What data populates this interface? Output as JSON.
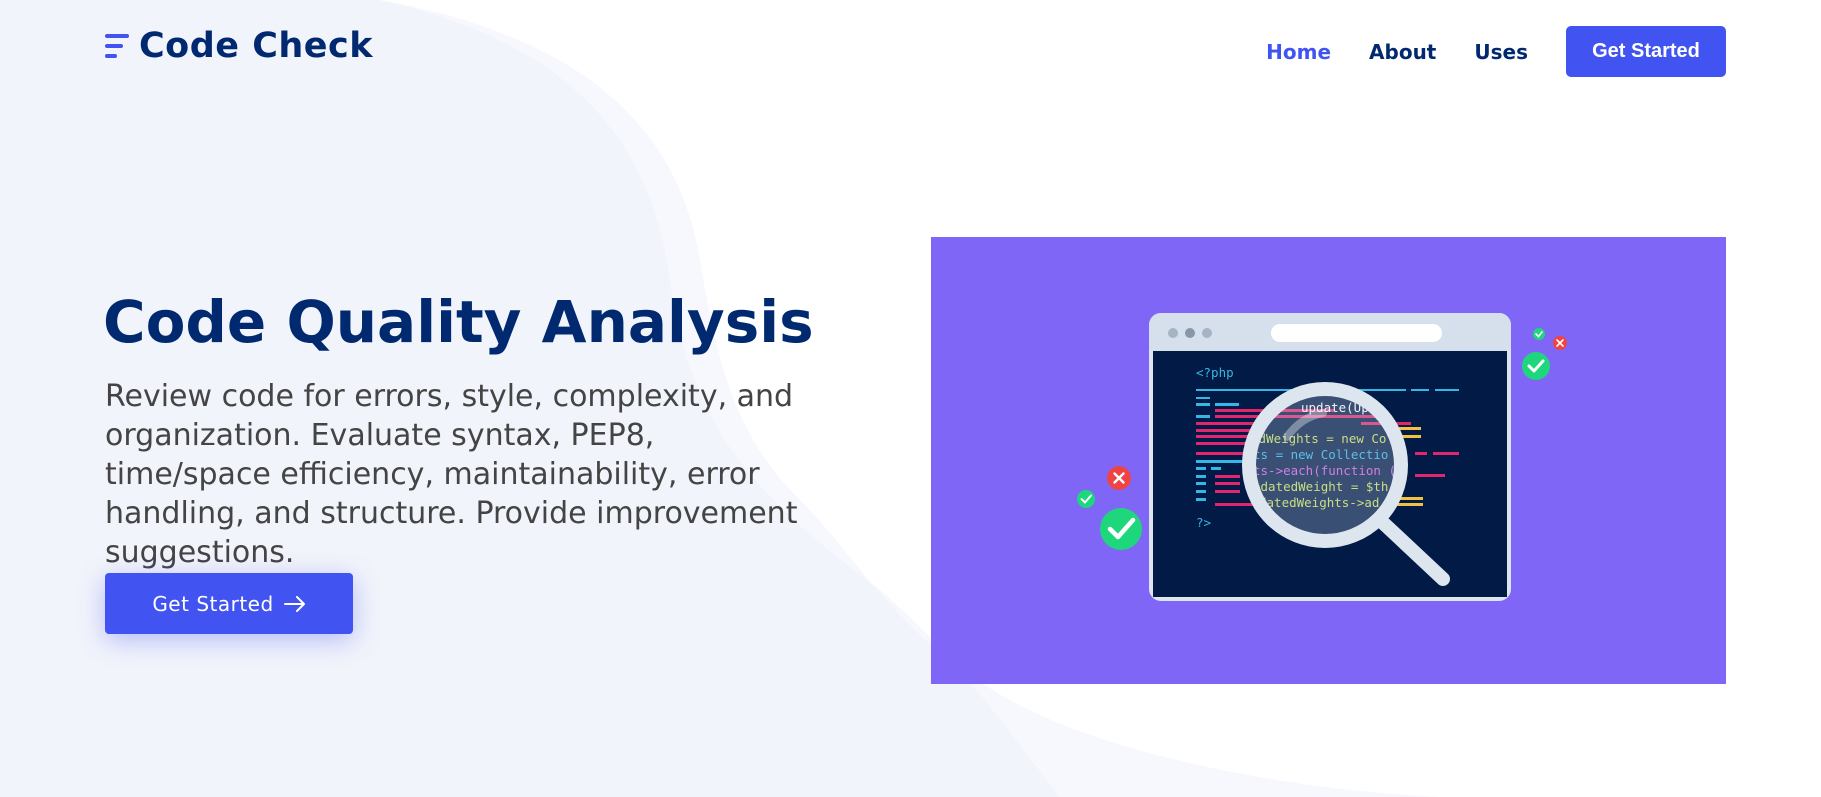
{
  "brand": {
    "name": "Code Check",
    "icon": "menu-lines-logo-icon",
    "primary_color": "#4154f1",
    "text_color": "#012970"
  },
  "nav": {
    "items": [
      {
        "label": "Home",
        "active": true
      },
      {
        "label": "About",
        "active": false
      },
      {
        "label": "Uses",
        "active": false
      }
    ],
    "cta_label": "Get Started"
  },
  "hero": {
    "title": "Code Quality Analysis",
    "description": "Review code for errors, style, complexity, and organization. Evaluate syntax, PEP8, time/space efficiency, maintainability, error handling, and structure. Provide improvement suggestions.",
    "cta_label": "Get Started",
    "cta_icon": "arrow-right-icon",
    "illustration": {
      "background_color": "#7f66f6",
      "code_lines": {
        "open_tag": "<?php",
        "line1": "update(Up",
        "line2": "edWeights = new Co",
        "line3": "ts = new Collectio",
        "line4": "ts->each(function (",
        "line5": "pdatedWeight = $th",
        "line6": "datedWeights->ad",
        "close_tag": "?>"
      }
    }
  }
}
